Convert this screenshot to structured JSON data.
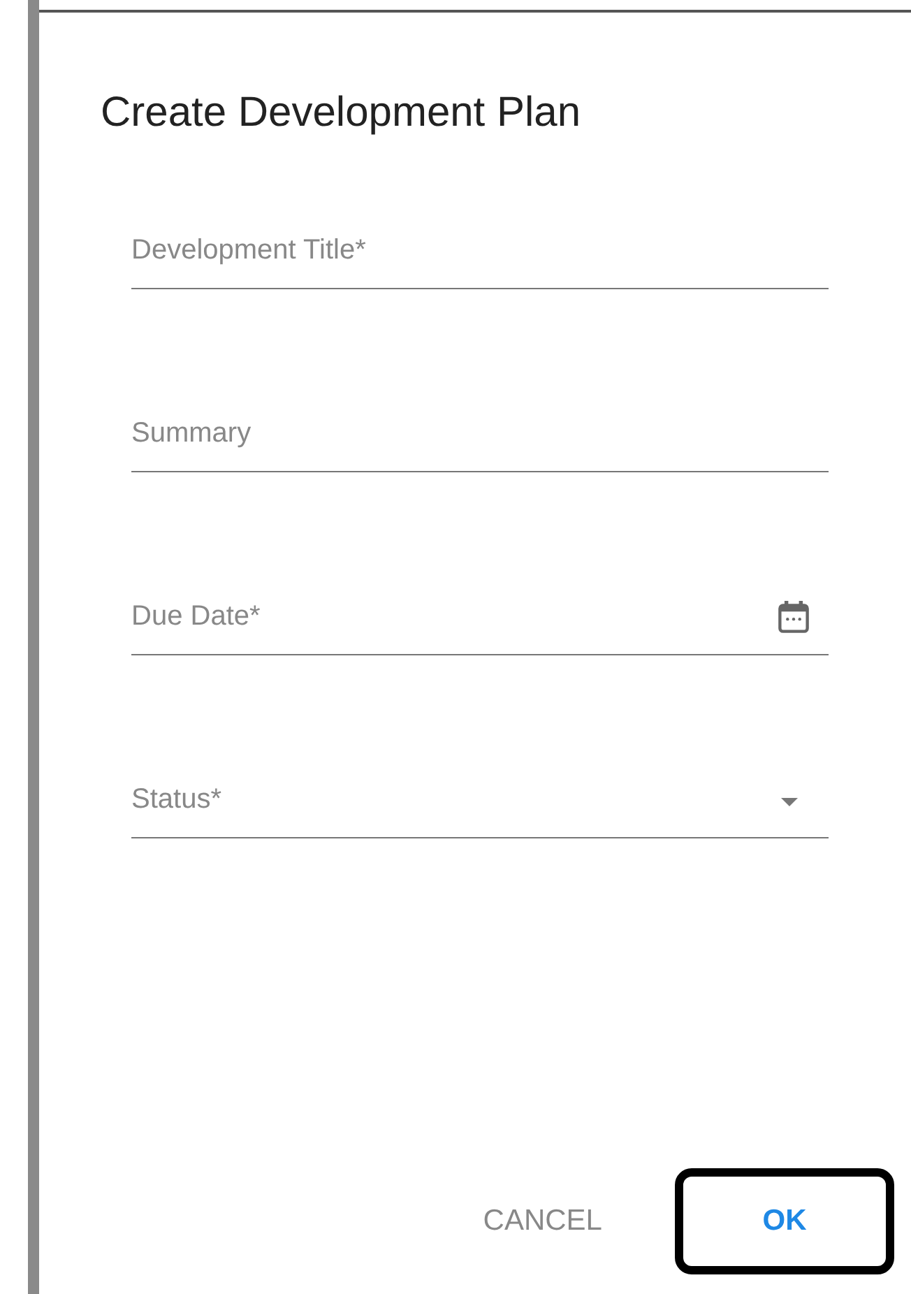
{
  "dialog": {
    "title": "Create Development Plan",
    "fields": [
      {
        "kind": "text",
        "placeholder": "Development Title*"
      },
      {
        "kind": "text",
        "placeholder": "Summary"
      },
      {
        "kind": "date",
        "placeholder": "Due Date*"
      },
      {
        "kind": "select",
        "placeholder": "Status*"
      }
    ],
    "buttons": [
      {
        "label": "CANCEL",
        "kind": "secondary",
        "highlighted": false
      },
      {
        "label": "OK",
        "kind": "primary",
        "highlighted": true
      }
    ]
  }
}
